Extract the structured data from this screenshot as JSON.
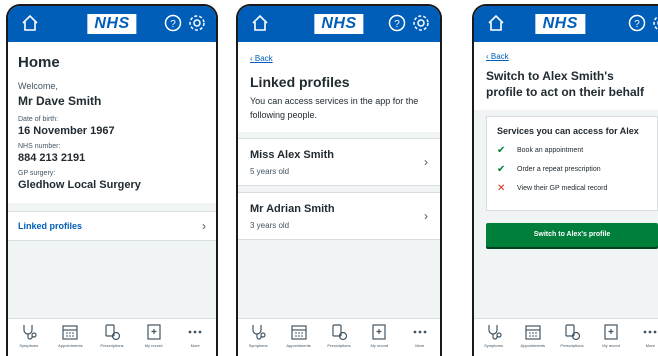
{
  "header": {
    "logo_text": "NHS"
  },
  "screen1": {
    "title": "Home",
    "welcome": "Welcome,",
    "name": "Mr Dave Smith",
    "dob_label": "Date of birth:",
    "dob_value": "16 November 1967",
    "nhs_label": "NHS number:",
    "nhs_value": "884 213 2191",
    "gp_label": "GP surgery:",
    "gp_value": "Gledhow Local Surgery",
    "linked_profiles_link": "Linked profiles"
  },
  "screen2": {
    "back": "Back",
    "title": "Linked profiles",
    "description": "You can access services in the app for the following people.",
    "profiles": [
      {
        "name": "Miss Alex Smith",
        "age": "5 years old"
      },
      {
        "name": "Mr Adrian Smith",
        "age": "3 years old"
      }
    ]
  },
  "screen3": {
    "back": "Back",
    "title_line1": "Switch to Alex Smith's",
    "title_line2": "profile to act on their behalf",
    "services_title": "Services you can access for Alex",
    "services": [
      {
        "label": "Book an appointment",
        "allowed": true
      },
      {
        "label": "Order a repeat prescription",
        "allowed": true
      },
      {
        "label": "View their GP medical record",
        "allowed": false
      }
    ],
    "switch_button": "Switch to Alex's profile"
  },
  "navbar": {
    "items": [
      "Symptoms",
      "Appointments",
      "Prescriptions",
      "My record",
      "More"
    ]
  },
  "colors": {
    "nhs_blue": "#005eb8",
    "green": "#007f3b",
    "red": "#d5281b",
    "background": "#f0f4f5"
  }
}
